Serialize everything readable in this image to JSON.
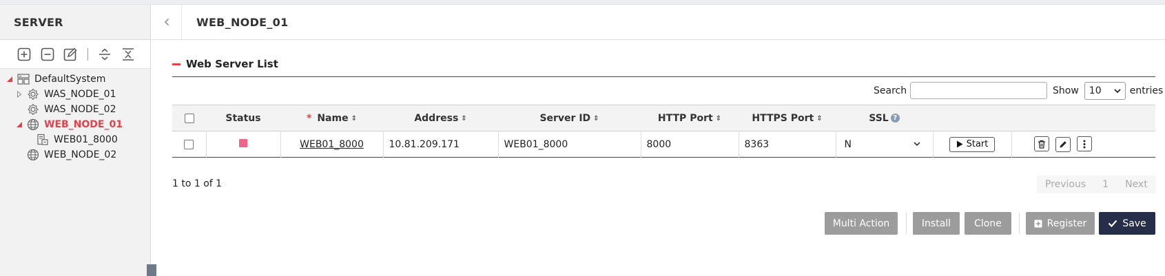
{
  "sidebar": {
    "title": "SERVER",
    "tree": [
      {
        "label": "DefaultSystem"
      },
      {
        "label": "WAS_NODE_01"
      },
      {
        "label": "WAS_NODE_02"
      },
      {
        "label": "WEB_NODE_01"
      },
      {
        "label": "WEB01_8000"
      },
      {
        "label": "WEB_NODE_02"
      }
    ]
  },
  "header": {
    "title": "WEB_NODE_01"
  },
  "section": {
    "title": "Web Server List"
  },
  "controls": {
    "search_label": "Search",
    "search_value": "",
    "show_label": "Show",
    "page_size": "10",
    "entries_label": "entries"
  },
  "table": {
    "columns": {
      "status": "Status",
      "required_mark": "*",
      "name": "Name",
      "address": "Address",
      "server_id": "Server ID",
      "http_port": "HTTP Port",
      "https_port": "HTTPS Port",
      "ssl": "SSL",
      "ssl_help": "?"
    },
    "rows": [
      {
        "status_color": "#f0668a",
        "name": "WEB01_8000",
        "address": "10.81.209.171",
        "server_id": "WEB01_8000",
        "http_port": "8000",
        "https_port": "8363",
        "ssl": "N",
        "start_label": "Start"
      }
    ]
  },
  "footer": {
    "info": "1 to 1 of 1",
    "pagination": {
      "previous": "Previous",
      "current": "1",
      "next": "Next"
    }
  },
  "actions": {
    "multi_action": "Multi Action",
    "install": "Install",
    "clone": "Clone",
    "register": "Register",
    "save": "Save"
  },
  "colors": {
    "accent": "#e5414b",
    "primary_dark": "#262e4a",
    "secondary": "#9c9c9c"
  }
}
